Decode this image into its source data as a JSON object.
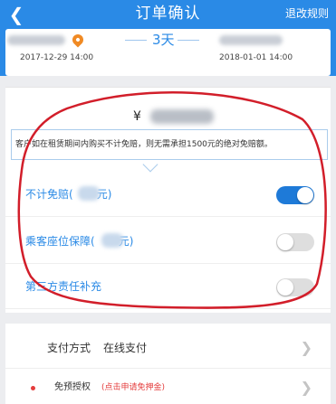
{
  "header": {
    "back_icon": "chevron-left-icon",
    "title": "订单确认",
    "rules_label": "退改规则",
    "bg_color": "#2a8ae6"
  },
  "trip": {
    "duration": "3天",
    "pickup_date": "2017-12-29 14:00",
    "return_date": "2018-01-01 14:00",
    "location_icon": "map-pin-icon"
  },
  "price": {
    "symbol": "¥"
  },
  "notice": {
    "text": "客户如在租赁期间内购买不计免赔，则无需承担1500元的绝对免赔额。"
  },
  "options": [
    {
      "label": "不计免赔(",
      "suffix": "元)",
      "enabled": true
    },
    {
      "label": "乘客座位保障(",
      "suffix": "元)",
      "enabled": false
    },
    {
      "label": "第三方责任补充",
      "suffix": "",
      "enabled": false
    }
  ],
  "payment": {
    "label": "支付方式",
    "value": "在线支付"
  },
  "preauth": {
    "label": "免预授权",
    "note": "(点击申请免押金)"
  },
  "annotation": {
    "color": "#d21e2a"
  },
  "colors": {
    "accent": "#2a8ae6",
    "toggle_on": "#1e7ad8",
    "danger": "#e43c3c"
  }
}
